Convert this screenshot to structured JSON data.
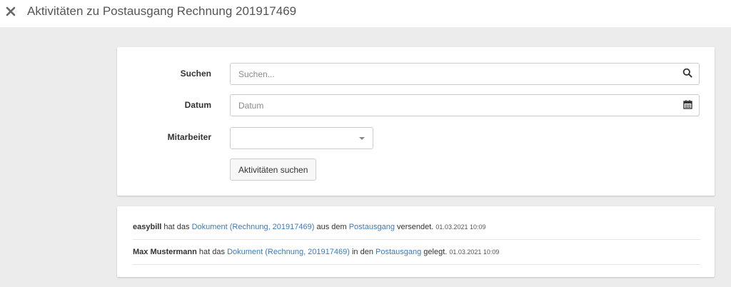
{
  "header": {
    "title": "Aktivitäten zu Postausgang Rechnung 201917469",
    "close_icon": "close-icon"
  },
  "search_form": {
    "search": {
      "label": "Suchen",
      "placeholder": "Suchen...",
      "value": "",
      "icon": "search-icon"
    },
    "date": {
      "label": "Datum",
      "placeholder": "Datum",
      "value": "",
      "icon": "calendar-icon"
    },
    "employee": {
      "label": "Mitarbeiter",
      "selected": "",
      "icon": "chevron-down-icon"
    },
    "submit_label": "Aktivitäten suchen"
  },
  "activities": [
    {
      "user": "easybill",
      "text1": " hat das ",
      "link1": "Dokument (Rechnung, 201917469)",
      "text2": " aus dem ",
      "link2": "Postausgang",
      "text3": " versendet. ",
      "time": "01.03.2021 10:09"
    },
    {
      "user": "Max Mustermann",
      "text1": " hat das ",
      "link1": "Dokument (Rechnung, 201917469)",
      "text2": " in den ",
      "link2": "Postausgang",
      "text3": " gelegt. ",
      "time": "01.03.2021 10:09"
    }
  ],
  "colors": {
    "background": "#ececec",
    "link": "#3a7bbf",
    "panel": "#ffffff"
  }
}
